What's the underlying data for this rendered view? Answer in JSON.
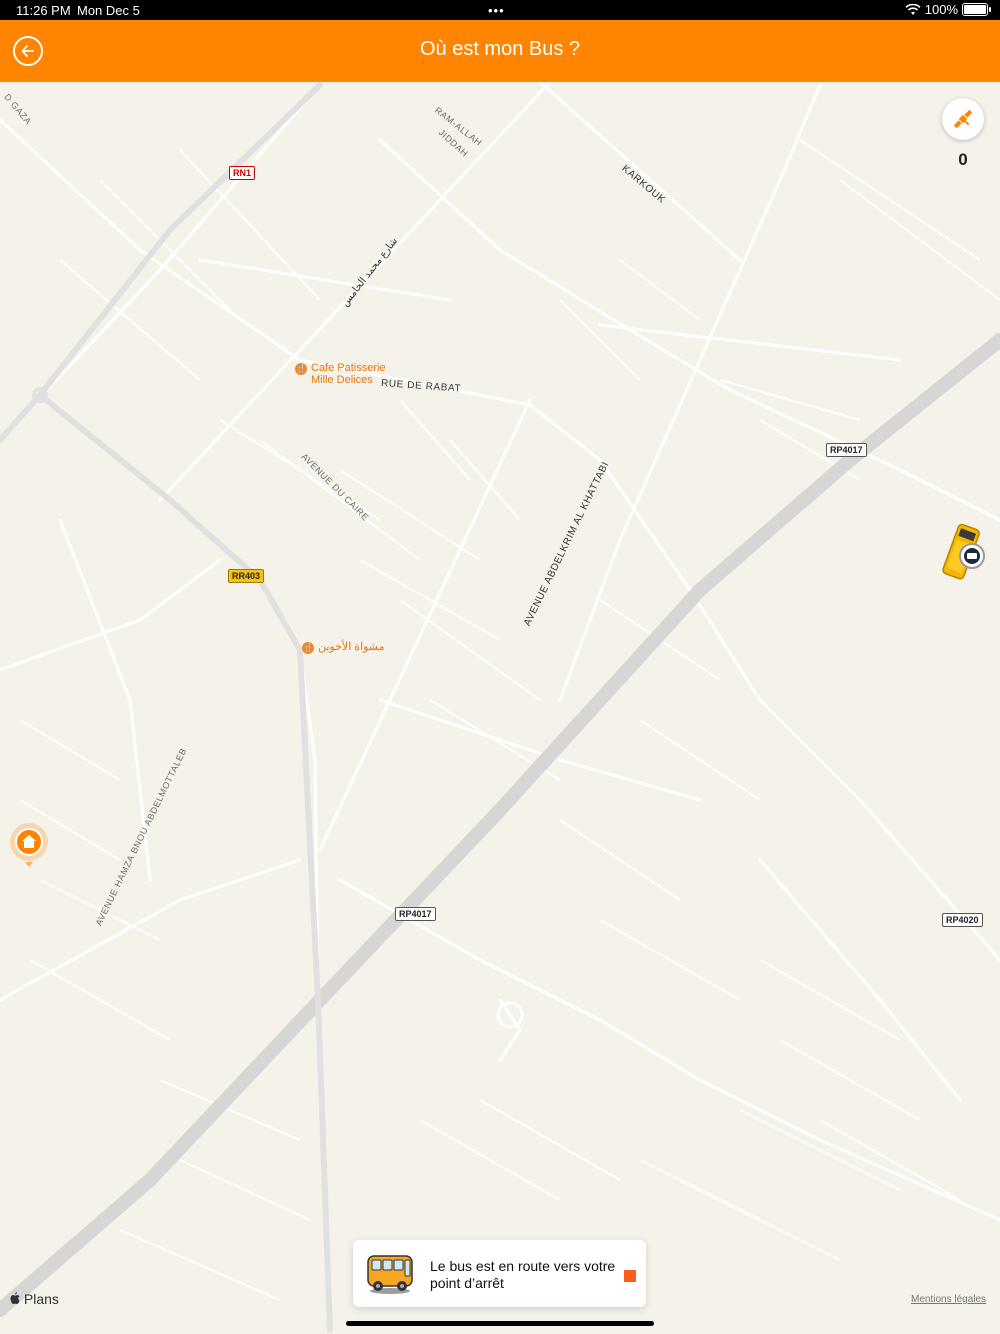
{
  "status_bar": {
    "time": "11:26 PM",
    "date": "Mon Dec 5",
    "dots": "•••",
    "battery": "100%"
  },
  "header": {
    "title": "Où est mon Bus ?",
    "back_icon": "back-arrow-icon"
  },
  "map": {
    "roads": [
      {
        "label": "RN1"
      },
      {
        "label": "RR403"
      },
      {
        "label": "RP4017"
      },
      {
        "label": "RP4017"
      },
      {
        "label": "RP4020"
      }
    ],
    "streets": {
      "gaza": "D GAZA",
      "ramallah": "RAM-ALLAH",
      "jiddah": "JIDDAH",
      "karkouk": "KARKOUK",
      "mohammed_v": "شارع محمد الخامس",
      "rue_de_rabat": "RUE DE RABAT",
      "avenue_du_caire": "AVENUE DU CAIRE",
      "abdelkrim": "AVENUE ABDELKRIM AL KHATTABI",
      "hamza": "AVENUE HAMZA BNOU ABDELMOTTALEB"
    },
    "pois": {
      "cafe_line1": "Cafe Patisserie",
      "cafe_line2": "Mille Delices",
      "grill": "مشواة الأخوين"
    },
    "attribution": "Plans",
    "legal": "Mentions légales",
    "satellite": {
      "icon": "satellite-icon",
      "count": "0"
    },
    "markers": {
      "bus": "bus-marker-icon",
      "home": "home-marker-icon"
    }
  },
  "toast": {
    "message": "Le bus est en route vers votre point d’arrêt",
    "icon": "school-bus-icon"
  },
  "colors": {
    "accent": "#ff8400",
    "map_bg": "#f5f2ea",
    "road": "#ffffff",
    "highway": "#d9d9d9",
    "toast_close": "#ff5a1f"
  }
}
